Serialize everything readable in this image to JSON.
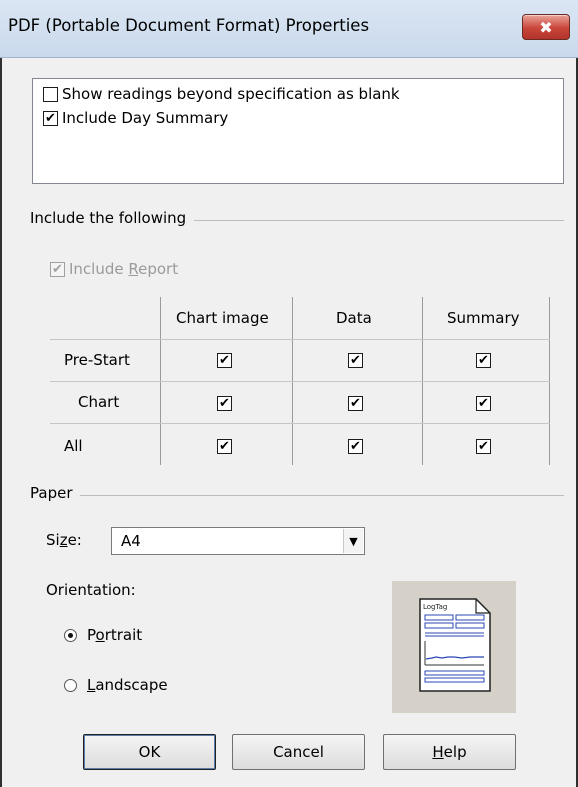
{
  "window": {
    "title": "PDF (Portable Document Format) Properties",
    "close_glyph": "✖"
  },
  "options": [
    {
      "label": "Show readings beyond specification as blank",
      "checked": false
    },
    {
      "label": "Include Day Summary",
      "checked": true
    }
  ],
  "include_group": {
    "label": "Include the following",
    "include_report": {
      "pre": "Include ",
      "accel": "R",
      "post": "eport",
      "checked": true,
      "disabled": true
    },
    "columns": [
      "Chart image",
      "Data",
      "Summary"
    ],
    "rows": [
      {
        "label": "Pre-Start",
        "values": [
          true,
          true,
          true
        ]
      },
      {
        "label": "Chart",
        "values": [
          true,
          true,
          true
        ]
      },
      {
        "label": "All",
        "values": [
          true,
          true,
          true
        ]
      }
    ]
  },
  "paper_group": {
    "label": "Paper",
    "size_label_pre": "Si",
    "size_label_accel": "z",
    "size_label_post": "e:",
    "size_value": "A4",
    "orientation_label": "Orientation:",
    "portrait": {
      "pre": "P",
      "accel": "o",
      "post": "rtrait",
      "selected": true
    },
    "landscape": {
      "pre": "",
      "accel": "L",
      "post": "andscape",
      "selected": false
    },
    "preview_logo": "LogTag"
  },
  "buttons": {
    "ok": "OK",
    "cancel": "Cancel",
    "help_accel": "H",
    "help_rest": "elp"
  },
  "colors": {
    "close_button": "#c9453a",
    "title_bar": "#c9d9ec",
    "dialog_bg": "#f0f0f0",
    "preview_line": "#2a47b5"
  }
}
